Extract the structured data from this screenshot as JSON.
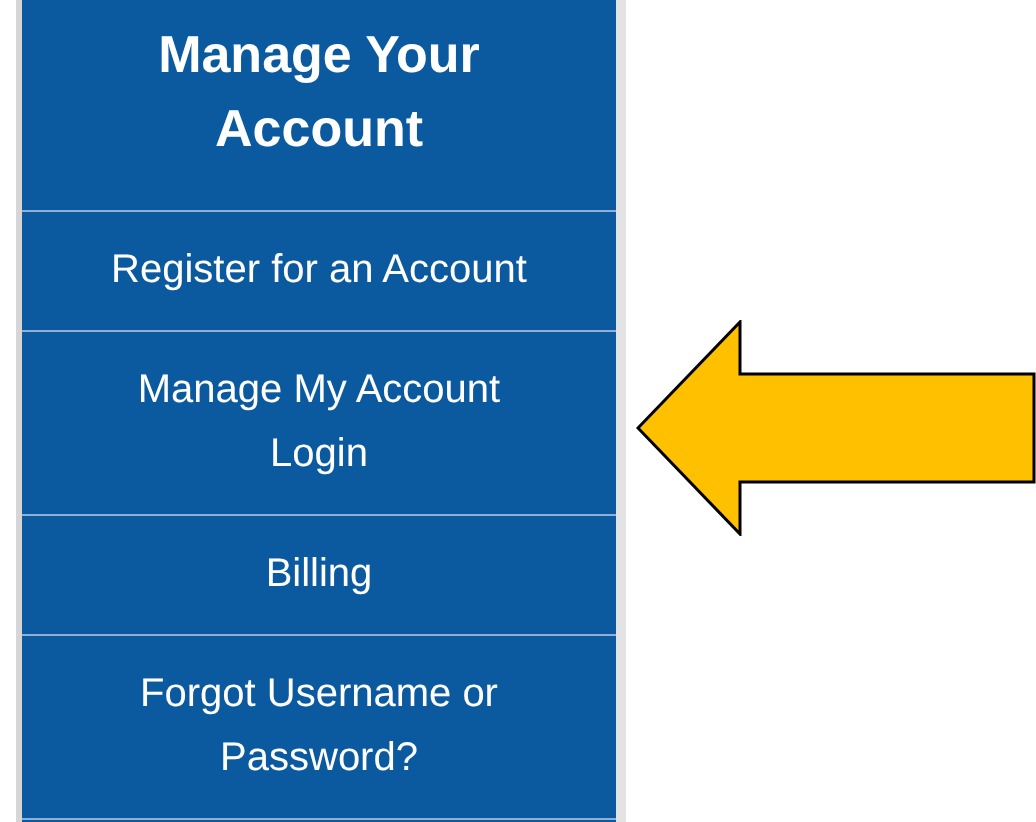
{
  "panel": {
    "title": "Manage Your Account",
    "items": [
      {
        "label": "Register for an Account"
      },
      {
        "label": "Manage My Account Login"
      },
      {
        "label": "Billing"
      },
      {
        "label": "Forgot Username or Password?"
      }
    ]
  }
}
